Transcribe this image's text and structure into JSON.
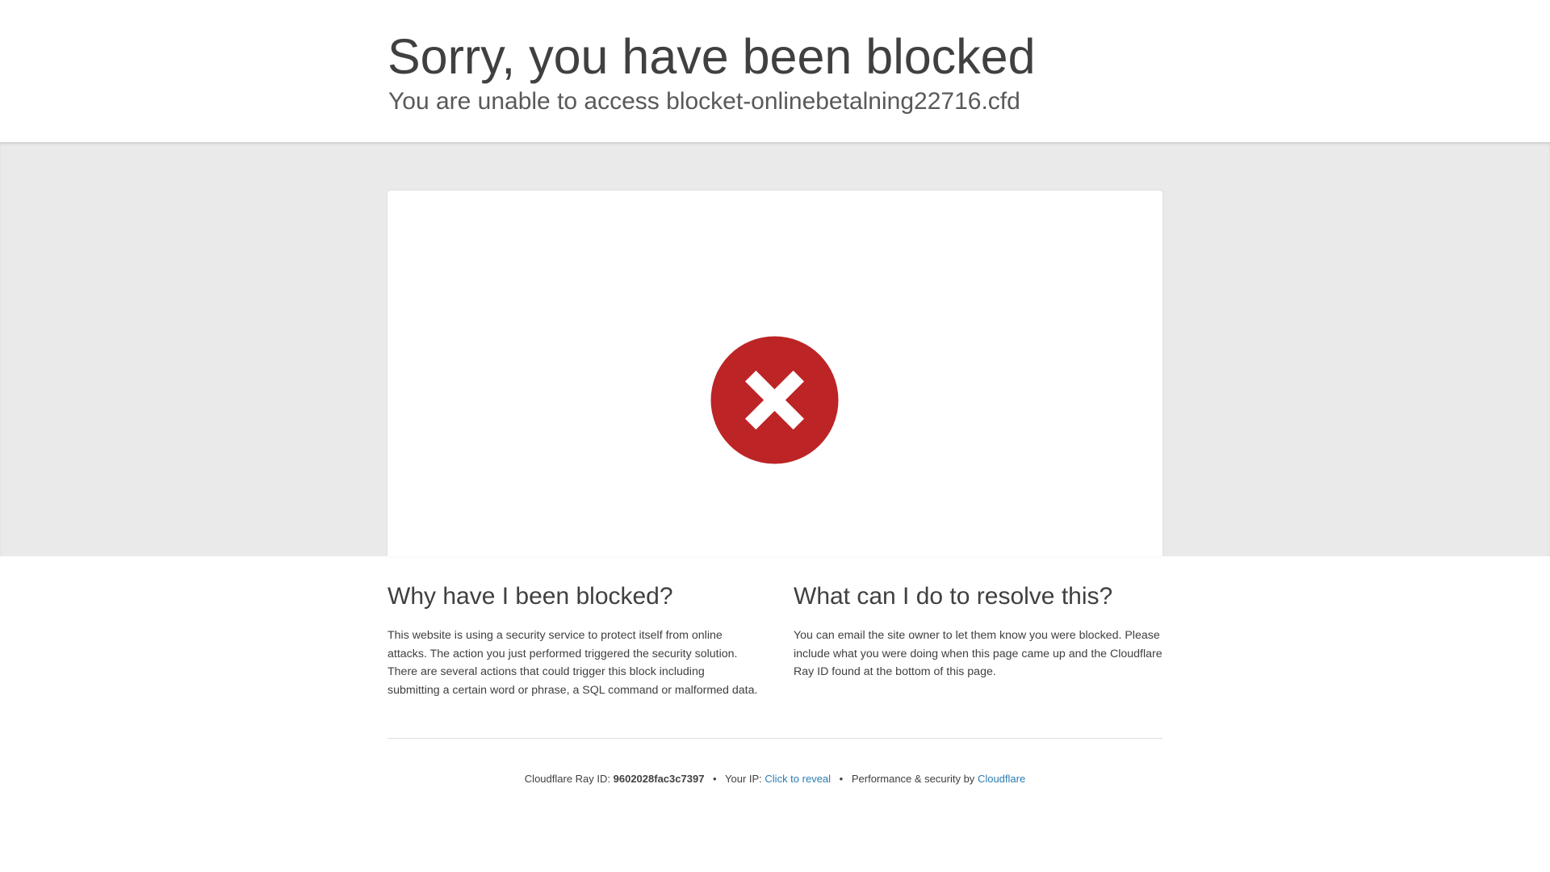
{
  "header": {
    "title": "Sorry, you have been blocked",
    "subtitle": "You are unable to access blocket-onlinebetalning22716.cfd"
  },
  "icon": {
    "name": "block-x-icon",
    "color": "#bd2426"
  },
  "why": {
    "heading": "Why have I been blocked?",
    "body": "This website is using a security service to protect itself from online attacks. The action you just performed triggered the security solution. There are several actions that could trigger this block including submitting a certain word or phrase, a SQL command or malformed data."
  },
  "resolve": {
    "heading": "What can I do to resolve this?",
    "body": "You can email the site owner to let them know you were blocked. Please include what you were doing when this page came up and the Cloudflare Ray ID found at the bottom of this page."
  },
  "footer": {
    "ray_label": "Cloudflare Ray ID:",
    "ray_id": "9602028fac3c7397",
    "separator": "•",
    "ip_label": "Your IP:",
    "ip_link": "Click to reveal",
    "perf_label": "Performance & security by",
    "brand_link": "Cloudflare",
    "link_color": "#2c7cb0"
  }
}
